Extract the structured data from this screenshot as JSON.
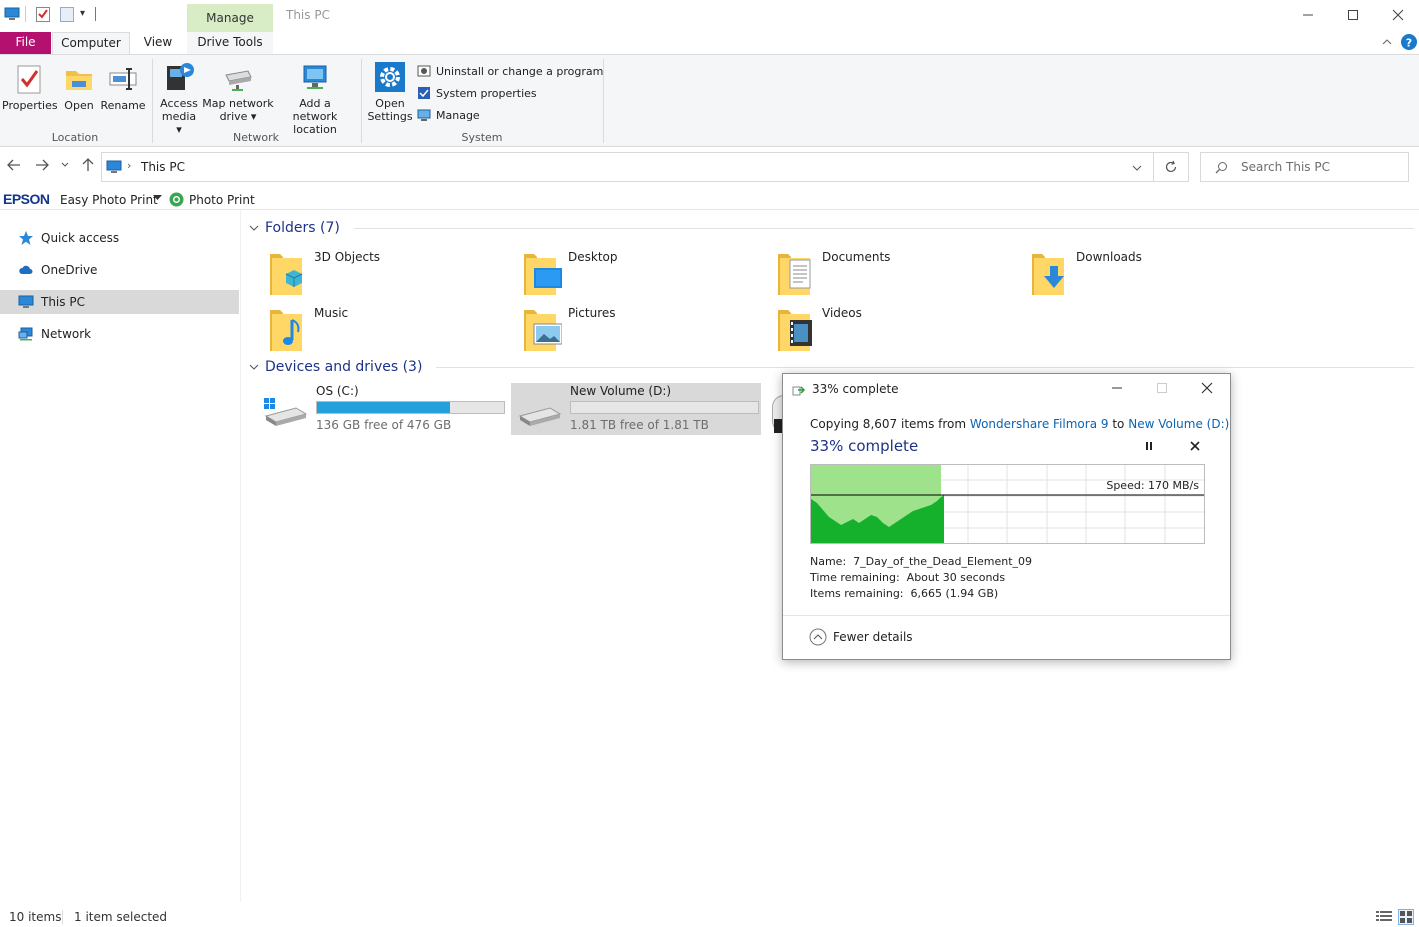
{
  "titlebar": {
    "context_tab": "Manage",
    "title": "This PC",
    "minimize": "—",
    "maximize": "☐",
    "close": "✕"
  },
  "ribbon": {
    "tabs": {
      "file": "File",
      "computer": "Computer",
      "view": "View",
      "drive_tools": "Drive Tools"
    },
    "location": {
      "label": "Location",
      "properties": "Properties",
      "open": "Open",
      "rename": "Rename"
    },
    "network": {
      "label": "Network",
      "access_media_1": "Access",
      "access_media_2": "media ▾",
      "map_drive_1": "Map network",
      "map_drive_2": "drive ▾",
      "add_location_1": "Add a network",
      "add_location_2": "location"
    },
    "system": {
      "label": "System",
      "open_settings_1": "Open",
      "open_settings_2": "Settings",
      "uninstall": "Uninstall or change a program",
      "system_properties": "System properties",
      "manage": "Manage"
    }
  },
  "addressbar": {
    "path": "This PC",
    "search_placeholder": "Search This PC"
  },
  "epson": {
    "brand": "EPSON",
    "easy_photo_print": "Easy Photo Print",
    "photo_print": "Photo Print"
  },
  "nav": {
    "quick_access": "Quick access",
    "onedrive": "OneDrive",
    "this_pc": "This PC",
    "network": "Network"
  },
  "folders": {
    "header": "Folders (7)",
    "items": [
      "3D Objects",
      "Desktop",
      "Documents",
      "Downloads",
      "Music",
      "Pictures",
      "Videos"
    ]
  },
  "drives": {
    "header": "Devices and drives (3)",
    "c": {
      "name": "OS (C:)",
      "free": "136 GB free of 476 GB",
      "used_fraction": 0.71
    },
    "d": {
      "name": "New Volume (D:)",
      "free": "1.81 TB free of 1.81 TB",
      "used_fraction": 0.0
    }
  },
  "copy_dialog": {
    "title": "33% complete",
    "copying_prefix": "Copying 8,607 items from",
    "source": "Wondershare Filmora 9",
    "to": "to",
    "destination": "New Volume (D:)",
    "progress_text": "33% complete",
    "progress_fraction": 0.33,
    "speed": "Speed: 170 MB/s",
    "name_label": "Name:",
    "name_value": "7_Day_of_the_Dead_Element_09",
    "time_label": "Time remaining:",
    "time_value": "About 30 seconds",
    "items_label": "Items remaining:",
    "items_value": "6,665 (1.94 GB)",
    "fewer_details": "Fewer details"
  },
  "status": {
    "items": "10 items",
    "selected": "1 item selected"
  }
}
